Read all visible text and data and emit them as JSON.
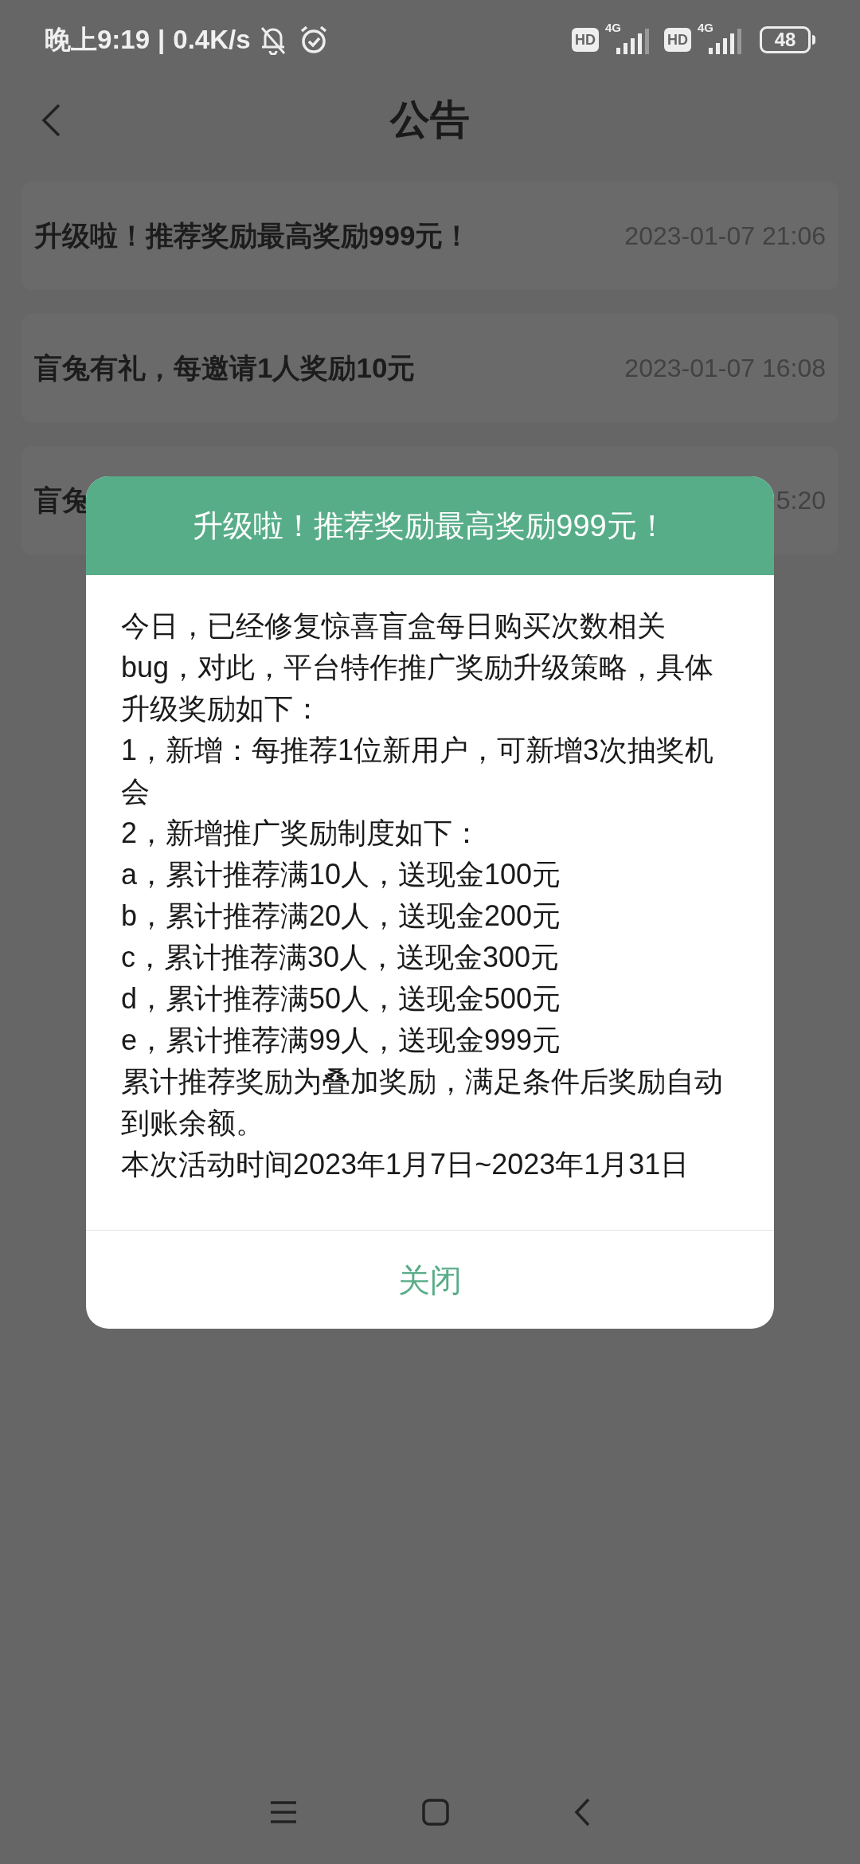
{
  "status_bar": {
    "time": "晚上9:19",
    "separator": "|",
    "speed": "0.4K/s",
    "battery": "48",
    "hd_badges": [
      "HD",
      "HD"
    ],
    "network": [
      "4G",
      "4G"
    ]
  },
  "header": {
    "title": "公告"
  },
  "notices": [
    {
      "title": "升级啦！推荐奖励最高奖励999元！",
      "time": "2023-01-07 21:06"
    },
    {
      "title": "盲兔有礼，每邀请1人奖励10元",
      "time": "2023-01-07 16:08"
    },
    {
      "title": "盲兔",
      "time": "5:20"
    }
  ],
  "dialog": {
    "title": "升级啦！推荐奖励最高奖励999元！",
    "paragraphs": [
      "今日，已经修复惊喜盲盒每日购买次数相关bug，对此，平台特作推广奖励升级策略，具体升级奖励如下：",
      "1，新增：每推荐1位新用户，可新增3次抽奖机会",
      "2，新增推广奖励制度如下：",
      "a，累计推荐满10人，送现金100元",
      "b，累计推荐满20人，送现金200元",
      "c，累计推荐满30人，送现金300元",
      "d，累计推荐满50人，送现金500元",
      "e，累计推荐满99人，送现金999元",
      "累计推荐奖励为叠加奖励，满足条件后奖励自动到账余额。",
      "本次活动时间2023年1月7日~2023年1月31日"
    ],
    "close_button": "关闭"
  }
}
